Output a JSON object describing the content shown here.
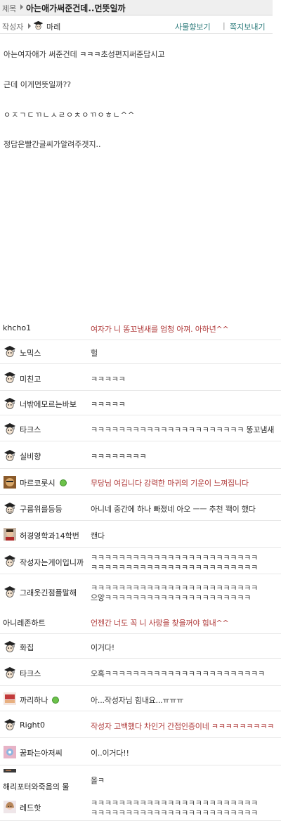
{
  "header": {
    "subject_label": "제목",
    "title": "아는애가써준건데..먼뜻일까",
    "author_label": "작성자",
    "author_name": "마레",
    "action_profile": "사물향보기",
    "action_separator": "|",
    "action_message": "쪽지보내기"
  },
  "post": {
    "lines": [
      "아는여자애가 써준건데  ㅋㅋㅋ초성편지써준답시고",
      "근데 이게먼뜻일까??",
      "ㅇㅈㄱㄷㄲㄴㅅㄹㅇㅊㅇㄲㅇㅎㄴ^^",
      "정답은빨간글씨가알려주겟지.."
    ]
  },
  "comments": [
    {
      "user": "khcho1",
      "text": "여자가 니 똥꼬냄새를 엄청 아껴. 아하년^^",
      "red": true,
      "avatar": "none"
    },
    {
      "user": "노믹스",
      "text": "헐",
      "red": false,
      "avatar": "grad"
    },
    {
      "user": "미친고",
      "text": "ㅋㅋㅋㅋㅋ",
      "red": false,
      "avatar": "grad"
    },
    {
      "user": "너밖에모르는바보",
      "text": "ㅋㅋㅋㅋㅋ",
      "red": false,
      "avatar": "grad"
    },
    {
      "user": "타크스",
      "text": "ㅋㅋㅋㅋㅋㅋㅋㅋㅋㅋㅋㅋㅋㅋㅋㅋㅋㅋㅋㅋㅋㅋ 똥꼬냄새",
      "red": false,
      "avatar": "grad"
    },
    {
      "user": "실비향",
      "text": "ㅋㅋㅋㅋㅋㅋㅋㅋ",
      "red": false,
      "avatar": "grad"
    },
    {
      "user": "마르코룻시",
      "text": "무당님 여깁니다 강력한 마귀의 기운이 느껴집니다",
      "red": true,
      "avatar": "photo-brown",
      "online": true
    },
    {
      "user": "구름위를등등",
      "text": "아니네 중간에 하나 빠졌네 아오 ㅡㅡ 추천 꽥이 했다",
      "red": false,
      "avatar": "grad-face"
    },
    {
      "user": "허경영학과14학번",
      "text": "캔다",
      "red": false,
      "avatar": "photo-face"
    },
    {
      "user": "작성자는게이입니까",
      "text": "ㅋㅋㅋㅋㅋㅋㅋㅋㅋㅋㅋㅋㅋㅋㅋㅋㅋㅋㅋㅋㅋㅋㅋㅋ",
      "text2": "ㅋㅋㅋㅋㅋㅋㅋㅋㅋㅋㅋㅋㅋㅋㅋㅋㅋㅋㅋㅋㅋㅋㅋㅋ",
      "red": false,
      "avatar": "grad"
    },
    {
      "user": "그래웃긴점플말해",
      "text": "ㅋㅋㅋㅋㅋㅋㅋㅋㅋㅋㅋㅋㅋㅋㅋㅋㅋㅋㅋㅋㅋㅋㅋㅋ",
      "text2": "으앙ㅋㅋㅋㅋㅋㅋㅋㅋㅋㅋㅋㅋㅋㅋㅋㅋㅋㅋㅋㅋㅋ",
      "red": false,
      "avatar": "grad"
    },
    {
      "user": "아니레존하트",
      "text": "언젠간 너도 꼭 니 사랑을 찾을꺼야 힘내^^",
      "red": true,
      "avatar": "none"
    },
    {
      "user": "화집",
      "text": "이거다!",
      "red": false,
      "avatar": "grad"
    },
    {
      "user": "타크스",
      "text": "오혹ㅋㅋㅋㅋㅋㅋㅋㅋㅋㅋㅋㅋㅋㅋㅋㅋㅋㅋㅋㅋㅋㅋㅋ",
      "red": false,
      "avatar": "grad"
    },
    {
      "user": "까리하나",
      "text": "아...작성자님 힘내요...ㅠㅠㅠ",
      "red": false,
      "avatar": "photo-red",
      "online": true
    },
    {
      "user": "Right0",
      "text": "작성자 고백했다 차인거 간접인증이네 ㅋㅋㅋㅋㅋㅋㅋㅋㅋ",
      "red": true,
      "avatar": "grad"
    },
    {
      "user": "꿈파는아저씨",
      "text": "이..이거다!!",
      "red": false,
      "avatar": "photo-pink"
    },
    {
      "user": "해리포터와죽음의   물",
      "text": "올ㅋ",
      "red": false,
      "avatar": "photo-dark"
    },
    {
      "user": "레드핫",
      "text": "ㅋㅋㅋㅋㅋㅋㅋㅋㅋㅋㅋㅋㅋㅋㅋㅋㅋㅋㅋㅋㅋㅋㅋㅋ",
      "text2": "ㅋㅋㅋㅋㅋㅋㅋㅋㅋㅋㅋㅋㅋㅋㅋㅋㅋㅋㅋㅋㅋㅋㅋㅋ",
      "red": false,
      "avatar": "photo-girl"
    }
  ],
  "colors": {
    "red_text": "#b03a3a",
    "action_link": "#2a7a7a",
    "online_dot": "#6cc24a"
  }
}
